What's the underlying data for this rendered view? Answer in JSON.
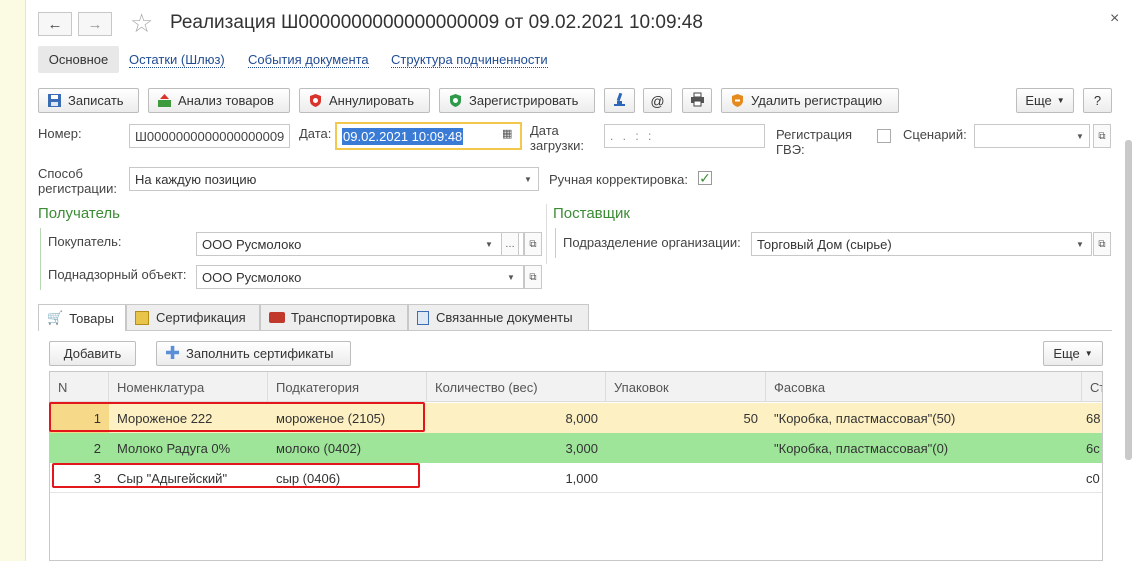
{
  "window": {
    "title": "Реализация Ш0000000000000000009 от 09.02.2021 10:09:48",
    "back": "←",
    "forward": "→",
    "star": "☆",
    "close": "×"
  },
  "nav": {
    "main_tab": "Основное",
    "links": [
      "Остатки (Шлюз)",
      "События документа",
      "Структура подчиненности"
    ]
  },
  "toolbar": {
    "save": "Записать",
    "analyze": "Анализ товаров",
    "cancel": "Аннулировать",
    "register": "Зарегистрировать",
    "delete_reg": "Удалить регистрацию",
    "more": "Еще",
    "help": "?"
  },
  "form": {
    "number_label": "Номер:",
    "number_value": "Ш0000000000000000009",
    "date_label": "Дата:",
    "date_value": "09.02.2021 10:09:48",
    "load_date_label_1": "Дата",
    "load_date_label_2": "загрузки:",
    "load_date_value": ". .   : :",
    "reg_gve_label_1": "Регистрация",
    "reg_gve_label_2": "ГВЭ:",
    "scenario_label": "Сценарий:",
    "scenario_value": "",
    "method_label_1": "Способ",
    "method_label_2": "регистрации:",
    "method_value": "На каждую позицию",
    "manual_label": "Ручная корректировка:",
    "manual_checked": "✓"
  },
  "recipient": {
    "title": "Получатель",
    "buyer_label": "Покупатель:",
    "buyer_value": "ООО Русмолоко",
    "object_label": "Поднадзорный объект:",
    "object_value": "ООО Русмолоко"
  },
  "supplier": {
    "title": "Поставщик",
    "division_label": "Подразделение организации:",
    "division_value": "Торговый Дом (сырье)"
  },
  "tabs": [
    "Товары",
    "Сертификация",
    "Транспортировка",
    "Связанные документы"
  ],
  "table_toolbar": {
    "add": "Добавить",
    "fill_cert": "Заполнить сертификаты",
    "more": "Еще"
  },
  "table": {
    "columns": [
      "N",
      "Номенклатура",
      "Подкатегория",
      "Количество (вес)",
      "Упаковок",
      "Фасовка",
      "Ст"
    ],
    "rows": [
      [
        "1",
        "Мороженое 222",
        "мороженое (2105)",
        "8,000",
        "50",
        "\"Коробка, пластмассовая\"(50)",
        "68"
      ],
      [
        "2",
        "Молоко Радуга 0%",
        "молоко (0402)",
        "3,000",
        "",
        "\"Коробка, пластмассовая\"(0)",
        "6c"
      ],
      [
        "3",
        "Сыр \"Адыгейский\"",
        "сыр (0406)",
        "1,000",
        "",
        "",
        "c0"
      ]
    ]
  },
  "colors": {
    "selected_row": "#fdf0c2",
    "green_row": "#9ee59a",
    "section": "#3b8c35",
    "link": "#1f4c93",
    "highlight": "#e2161b"
  }
}
